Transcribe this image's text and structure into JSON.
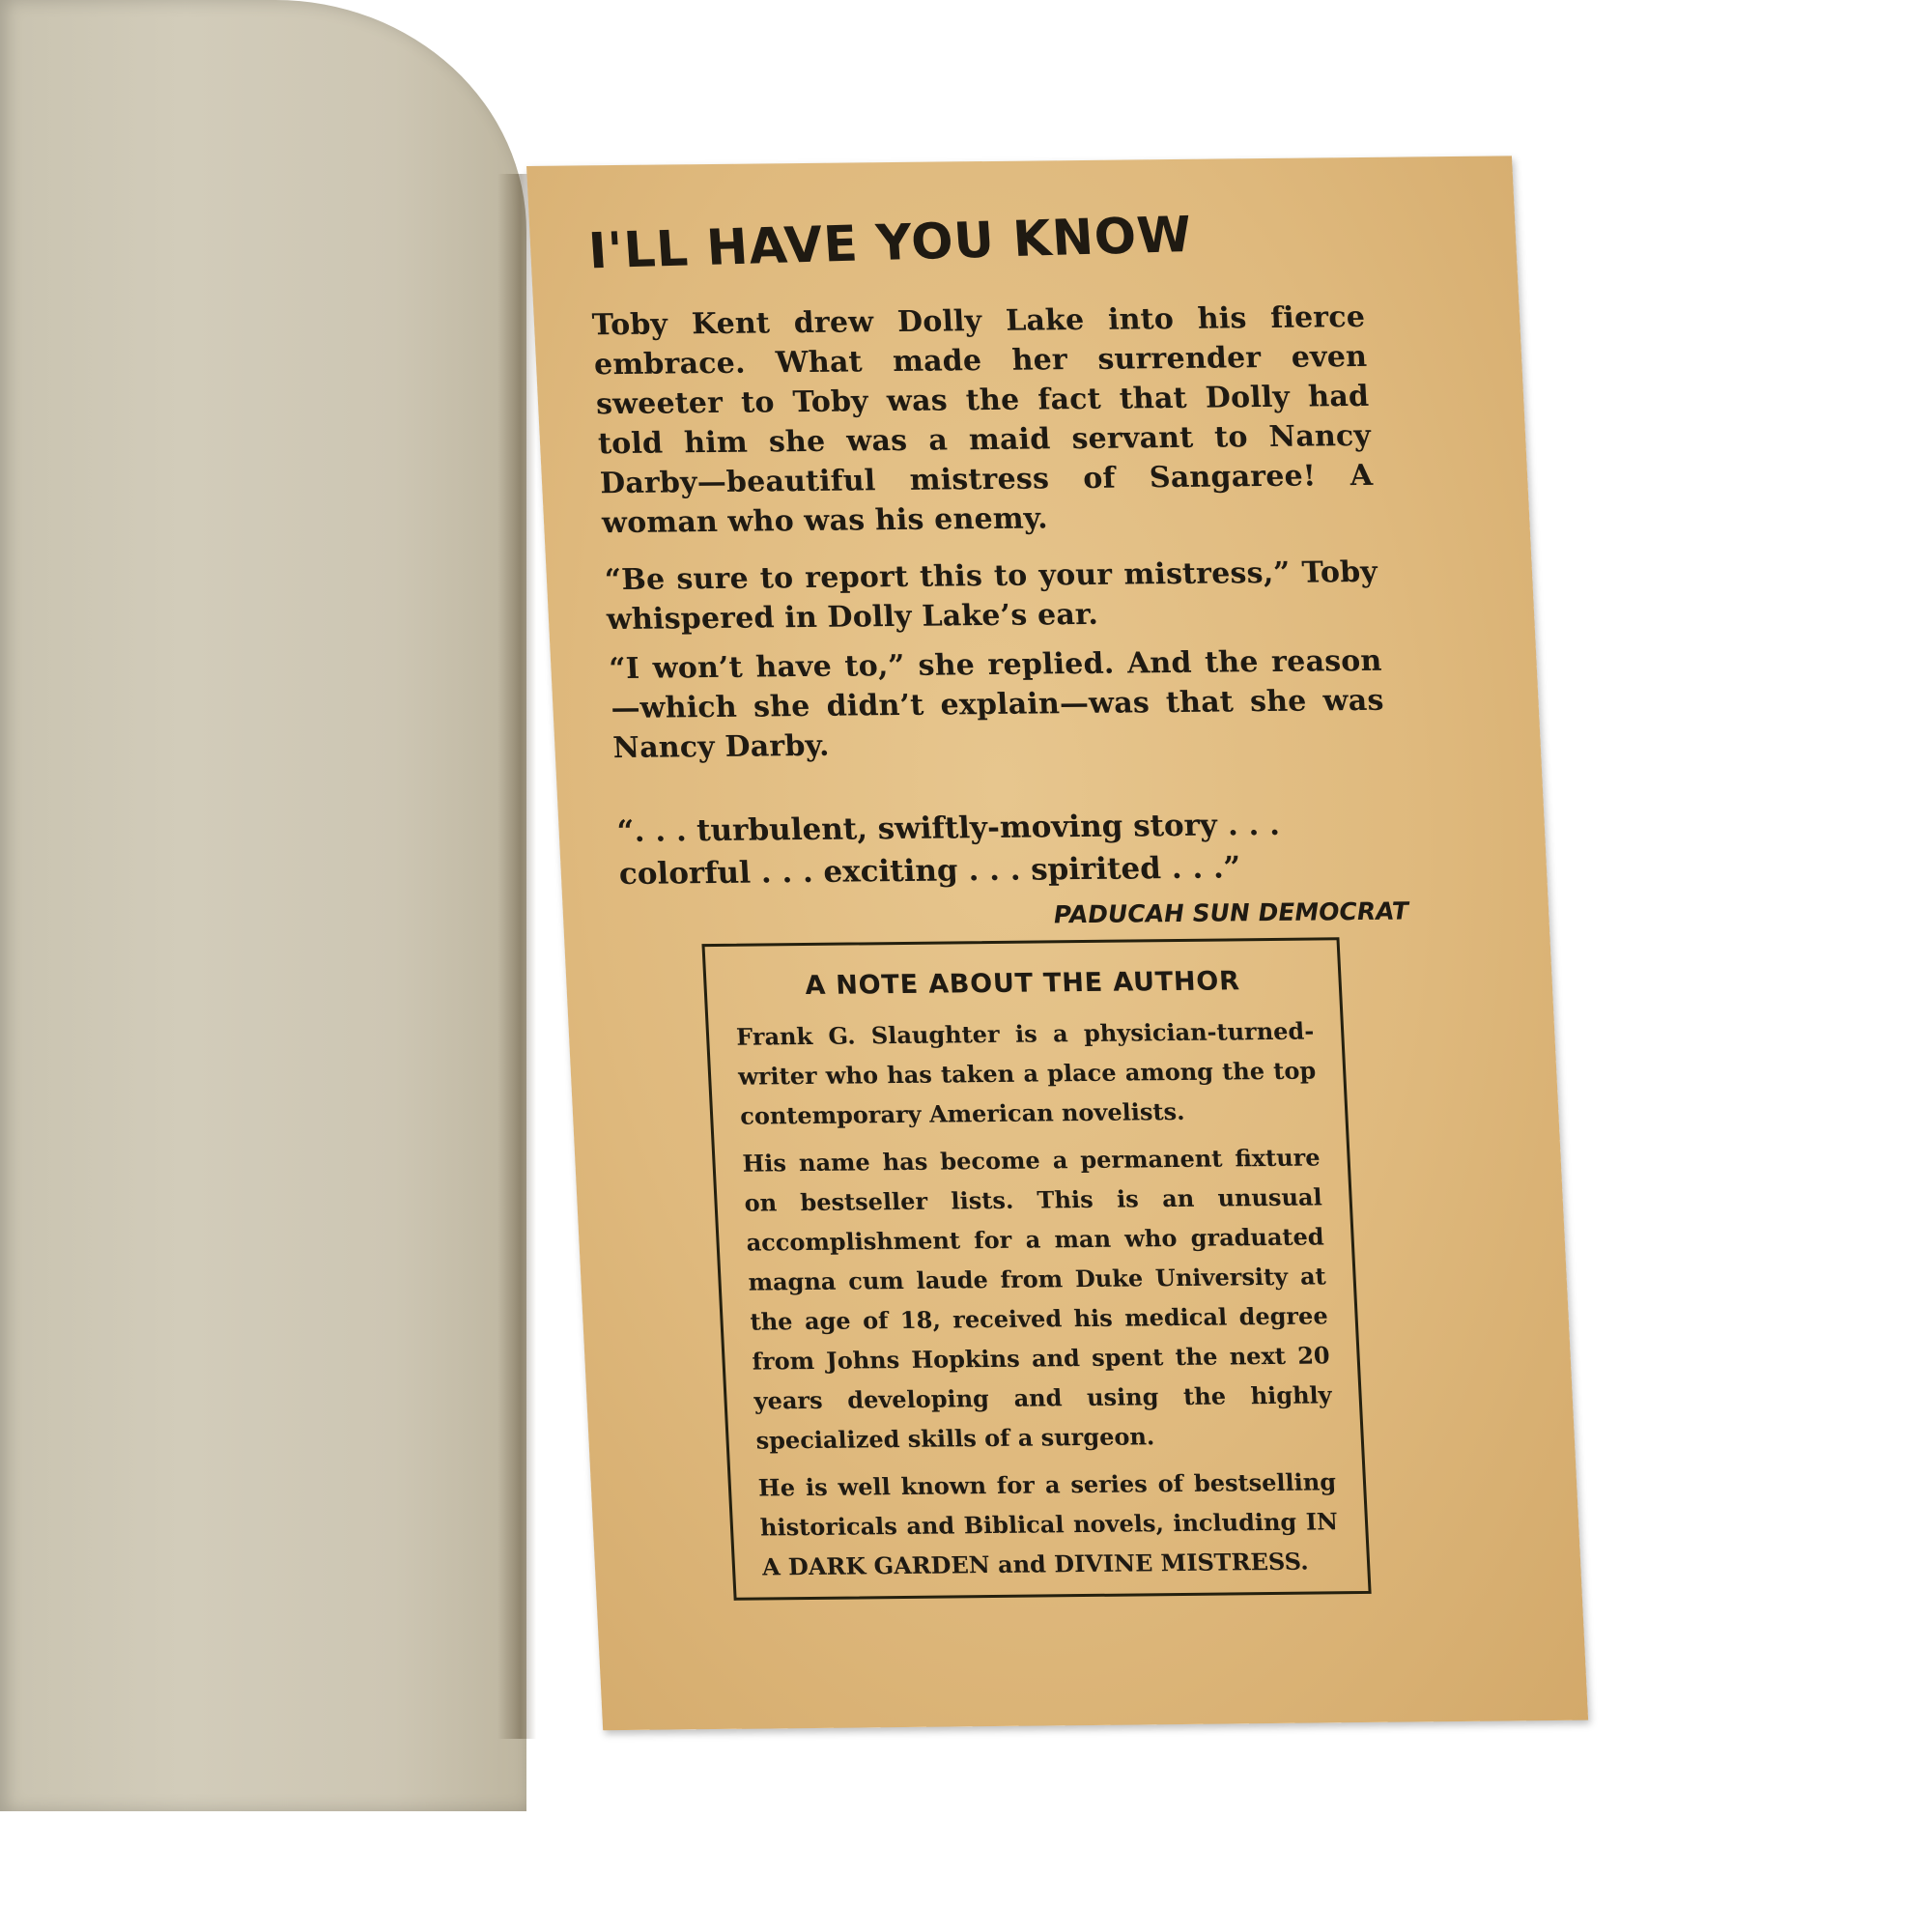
{
  "page": {
    "headline": "I'LL HAVE YOU KNOW",
    "blurb": [
      "Toby Kent drew Dolly Lake into his fierce embrace. What made her surrender even sweeter to Toby was the fact that Dolly had told him she was a maid servant to Nancy Darby—beautiful mistress of Sangaree! A woman who was his enemy.",
      "“Be sure to report this to your mistress,” Toby whispered in Dolly Lake’s ear.",
      "“I won’t have to,” she replied. And the reason—which she didn’t explain—was that she was Nancy Darby."
    ],
    "review_quote": "“. . . turbulent, swiftly-moving story . . . colorful . . . exciting . . . spirited . . .”",
    "review_source": "PADUCAH SUN DEMOCRAT",
    "author_note": {
      "title": "A NOTE ABOUT THE AUTHOR",
      "paragraphs": [
        "Frank G. Slaughter is a physician-turned-writer who has taken a place among the top contemporary American novelists.",
        "His name has become a permanent fixture on bestseller lists. This is an unusual accomplishment for a man who graduated magna cum laude from Duke University at the age of 18, received his medical degree from Johns Hopkins and spent the next 20 years developing and using the highly specialized skills of a surgeon.",
        "He is well known for a series of bestselling historicals and Biblical novels, including IN A DARK GARDEN and DIVINE MISTRESS."
      ]
    }
  },
  "colors": {
    "page_paper": "#dfb97d",
    "left_page": "#d2ccba",
    "cover_edge": "#9fae6c",
    "ink": "#1f1a12"
  }
}
